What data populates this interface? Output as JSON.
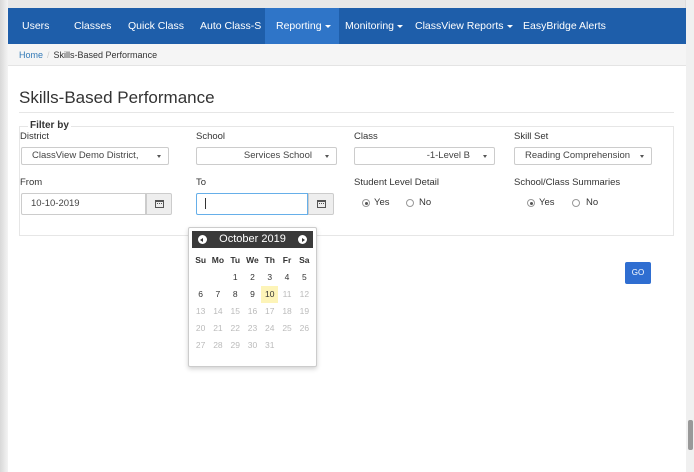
{
  "nav": {
    "items": [
      {
        "label": "Users",
        "dropdown": false,
        "active": false
      },
      {
        "label": "Classes",
        "dropdown": false,
        "active": false
      },
      {
        "label": "Quick Class",
        "dropdown": false,
        "active": false
      },
      {
        "label": "Auto Class-S",
        "dropdown": false,
        "active": false
      },
      {
        "label": "Reporting",
        "dropdown": true,
        "active": true
      },
      {
        "label": "Monitoring",
        "dropdown": true,
        "active": false
      },
      {
        "label": "ClassView Reports",
        "dropdown": true,
        "active": false
      },
      {
        "label": "EasyBridge Alerts",
        "dropdown": false,
        "active": false
      }
    ]
  },
  "breadcrumb": {
    "home": "Home",
    "separator": "/",
    "current": "Skills-Based Performance"
  },
  "page": {
    "title": "Skills-Based Performance"
  },
  "filter": {
    "legend": "Filter by",
    "district": {
      "label": "District",
      "value": "ClassView Demo District,"
    },
    "school": {
      "label": "School",
      "value": "Services School"
    },
    "class": {
      "label": "Class",
      "value": "-1-Level B"
    },
    "skill_set": {
      "label": "Skill Set",
      "value": "Reading Comprehension"
    },
    "from": {
      "label": "From",
      "value": "10-10-2019"
    },
    "to": {
      "label": "To",
      "value": ""
    },
    "student_level": {
      "label": "Student Level Detail",
      "yes": "Yes",
      "no": "No",
      "selected": "yes"
    },
    "summaries": {
      "label": "School/Class Summaries",
      "yes": "Yes",
      "no": "No",
      "selected": "yes"
    }
  },
  "go_button": {
    "label": "GO"
  },
  "datepicker": {
    "title": "October 2019",
    "weekdays": [
      "Su",
      "Mo",
      "Tu",
      "We",
      "Th",
      "Fr",
      "Sa"
    ],
    "weeks": [
      [
        null,
        null,
        "1",
        "2",
        "3",
        "4",
        "5"
      ],
      [
        "6",
        "7",
        "8",
        "9",
        "10",
        "11",
        "12"
      ],
      [
        "13",
        "14",
        "15",
        "16",
        "17",
        "18",
        "19"
      ],
      [
        "20",
        "21",
        "22",
        "23",
        "24",
        "25",
        "26"
      ],
      [
        "27",
        "28",
        "29",
        "30",
        "31",
        null,
        null
      ]
    ],
    "today": "10",
    "last_enabled": "10"
  },
  "colors": {
    "navbar": "#1e5eaa",
    "nav_active": "#2f75c8",
    "go_button": "#2f6ed1",
    "today_highlight": "#fdf4b8"
  },
  "icons": {
    "calendar": "calendar-icon",
    "prev": "chevron-left-circle-icon",
    "next": "chevron-right-circle-icon"
  }
}
